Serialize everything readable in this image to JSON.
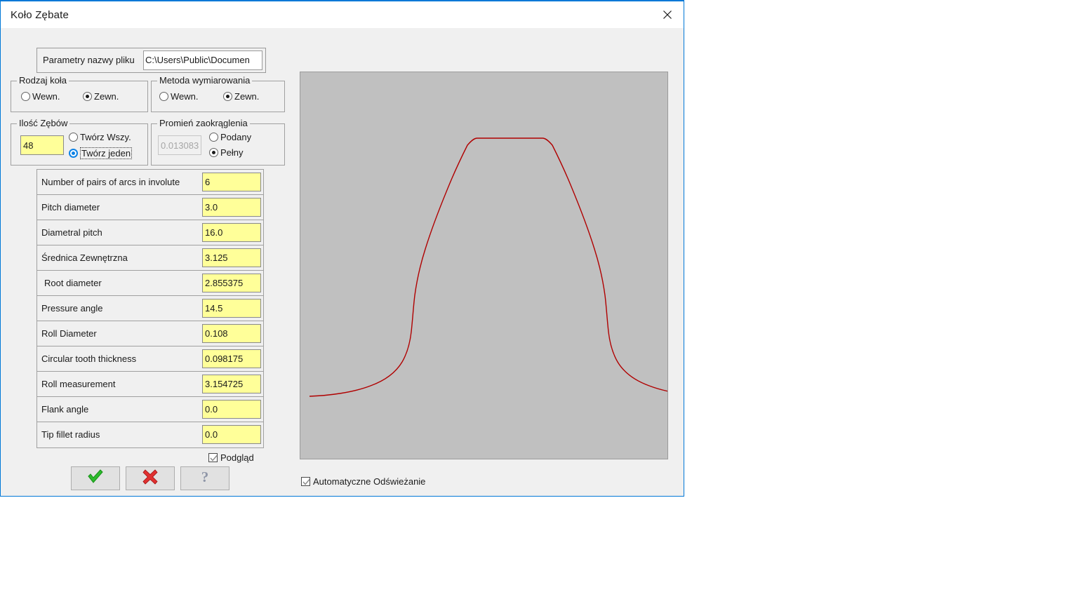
{
  "window": {
    "title": "Koło Zębate",
    "close_icon": "close-icon",
    "accent_color": "#0078d7",
    "face_color": "#f0f0f0"
  },
  "file_param": {
    "label": "Parametry nazwy pliku",
    "value": "C:\\Users\\Public\\Documen"
  },
  "groups": {
    "wheel_type": {
      "label": "Rodzaj koła",
      "options": [
        {
          "label": "Wewn.",
          "selected": false
        },
        {
          "label": "Zewn.",
          "selected": true
        }
      ]
    },
    "dimensioning_method": {
      "label": "Metoda wymiarowania",
      "options": [
        {
          "label": "Wewn.",
          "selected": false
        },
        {
          "label": "Zewn.",
          "selected": true
        }
      ]
    },
    "teeth_count": {
      "label": "Ilość Zębów",
      "value": "48",
      "options": [
        {
          "label": "Twórz Wszy.",
          "selected": false,
          "focused": false
        },
        {
          "label": "Twórz jeden",
          "selected": true,
          "focused": true
        }
      ]
    },
    "fillet_radius": {
      "label": "Promień zaokrąglenia",
      "value": "0.013083",
      "disabled": true,
      "options": [
        {
          "label": "Podany",
          "selected": false
        },
        {
          "label": "Pełny",
          "selected": true
        }
      ]
    }
  },
  "parameters": [
    {
      "label": "Number of pairs of arcs in involute",
      "value": "6"
    },
    {
      "label": "Pitch diameter",
      "value": "3.0"
    },
    {
      "label": "Diametral pitch",
      "value": "16.0"
    },
    {
      "label": "Średnica Zewnętrzna",
      "value": "3.125"
    },
    {
      "label": "Root diameter",
      "value": "2.855375"
    },
    {
      "label": "Pressure angle",
      "value": "14.5"
    },
    {
      "label": "Roll Diameter",
      "value": "0.108"
    },
    {
      "label": "Circular tooth thickness",
      "value": "0.098175"
    },
    {
      "label": "Roll measurement",
      "value": "3.154725"
    },
    {
      "label": "Flank angle",
      "value": "0.0"
    },
    {
      "label": "Tip fillet radius",
      "value": "0.0"
    }
  ],
  "preview_checkbox": {
    "label": "Podgląd",
    "checked": true
  },
  "auto_refresh_checkbox": {
    "label": "Automatyczne Odświeżanie",
    "checked": true
  },
  "buttons": [
    {
      "name": "ok-button",
      "icon": "green-check-icon"
    },
    {
      "name": "cancel-button",
      "icon": "red-cross-icon"
    },
    {
      "name": "help-button",
      "icon": "question-mark-icon"
    }
  ],
  "preview": {
    "background_color": "#c0c0c0",
    "curve_color": "#b00000",
    "description": "Involute gear tooth profile"
  }
}
